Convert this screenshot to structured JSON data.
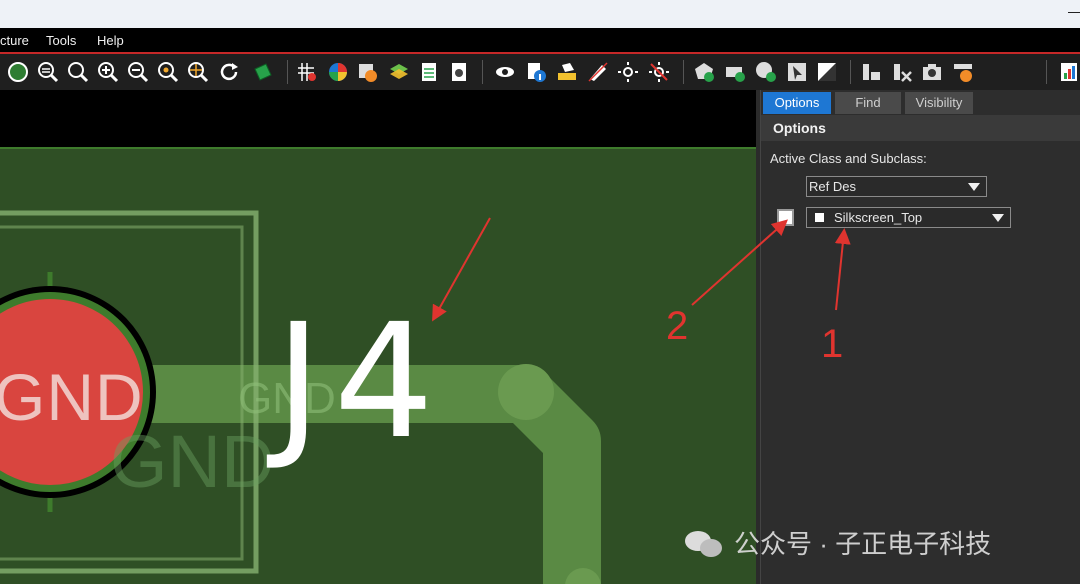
{
  "menu": {
    "items": [
      "cture",
      "Tools",
      "Help"
    ]
  },
  "panel": {
    "tabs": [
      "Options",
      "Find",
      "Visibility"
    ],
    "active_tab": "Options",
    "header": "Options",
    "active_class_label": "Active Class and Subclass:",
    "class_value": "Ref Des",
    "subclass_value": "Silkscreen_Top"
  },
  "board": {
    "refdes": "J4",
    "pad_label": "GND",
    "net_label": "GND",
    "trace_label": "GND"
  },
  "annotations": {
    "one": "1",
    "two": "2"
  },
  "watermark": {
    "text": "公众号 · 子正电子科技"
  },
  "colors": {
    "accent": "#1e77d3",
    "annotation": "#e0342f",
    "pad": "#d9453f",
    "board": "#2f4f25",
    "trace": "#5a8a44",
    "silkscreen": "#ffffff"
  }
}
